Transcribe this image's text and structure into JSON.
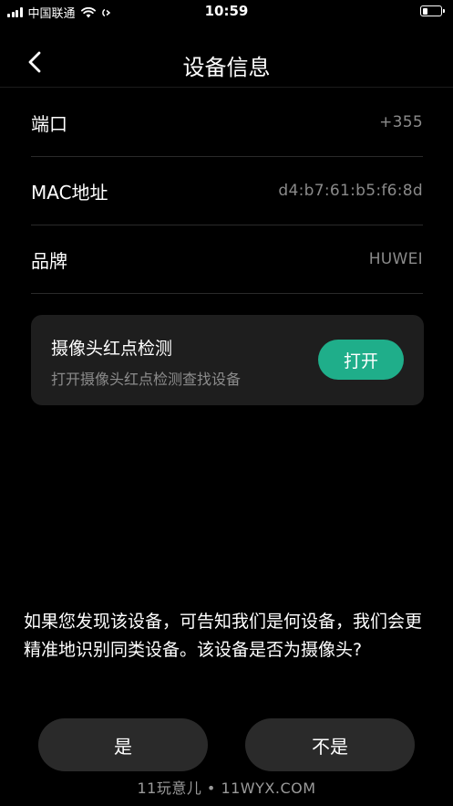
{
  "status_bar": {
    "carrier": "中国联通",
    "time": "10:59"
  },
  "nav": {
    "title": "设备信息"
  },
  "device_info": [
    {
      "label": "端口",
      "value": "+355"
    },
    {
      "label": "MAC地址",
      "value": "d4:b7:61:b5:f6:8d"
    },
    {
      "label": "品牌",
      "value": "HUWEI"
    }
  ],
  "camera_card": {
    "title": "摄像头红点检测",
    "subtitle": "打开摄像头红点检测查找设备",
    "button_label": "打开"
  },
  "question": {
    "text": "如果您发现该设备，可告知我们是何设备，我们会更精准地识别同类设备。该设备是否为摄像头?"
  },
  "answers": {
    "yes_label": "是",
    "no_label": "不是"
  },
  "watermark": "11玩意儿 • 11WYX.COM",
  "colors": {
    "background": "#000000",
    "card": "#1e1e1e",
    "accent": "#1fae8a",
    "muted_text": "#8a8a8a"
  }
}
